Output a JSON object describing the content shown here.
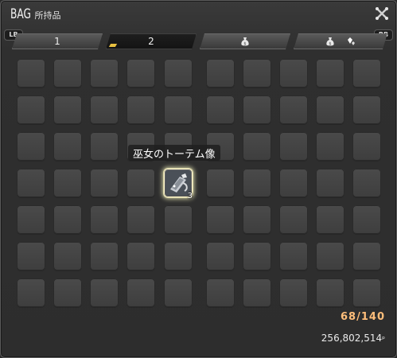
{
  "window": {
    "title": "BAG",
    "subtitle": "所持品"
  },
  "shoulders": {
    "left": "LB",
    "right": "RB"
  },
  "tabs": [
    {
      "label": "1",
      "icons": []
    },
    {
      "label": "2",
      "icons": [],
      "active": true
    },
    {
      "label": "",
      "icons": [
        "money-bag-icon"
      ]
    },
    {
      "label": "",
      "icons": [
        "money-bag-icon",
        "crystal-icon"
      ]
    }
  ],
  "inventory": {
    "item": {
      "name": "巫女のトーテム像",
      "quantity": "3",
      "icon": "totem-icon"
    },
    "capacity": "68/140",
    "gil": "256,802,514",
    "gil_symbol": "ᵖ"
  },
  "colors": {
    "capacity": "#ffbe7a",
    "active_tab_marker": "#e8c040"
  }
}
